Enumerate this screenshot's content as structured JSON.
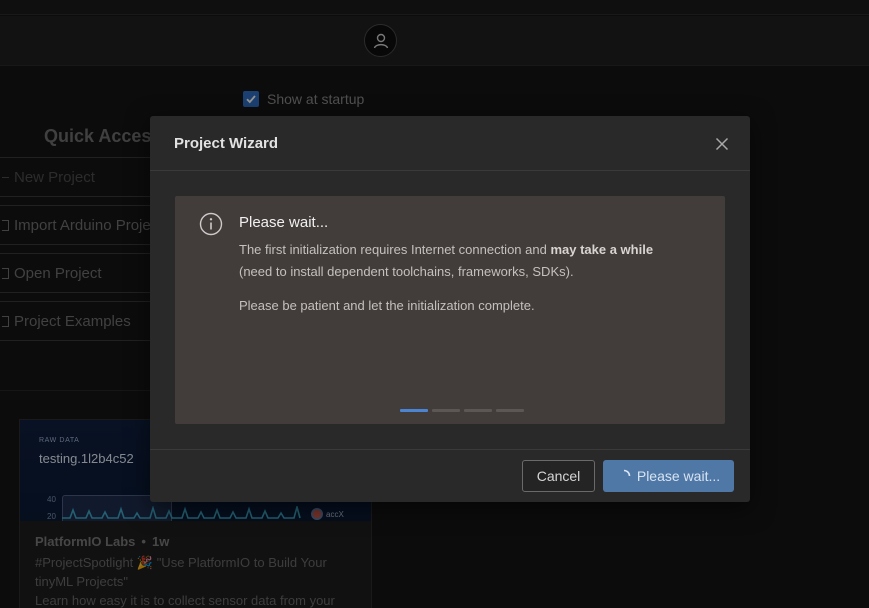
{
  "background": {
    "show_at_startup_label": "Show at startup",
    "show_at_startup_checked": true,
    "quick_access": {
      "title": "Quick Access",
      "items": [
        {
          "label": "New Project"
        },
        {
          "label": "Import Arduino Project"
        },
        {
          "label": "Open Project"
        },
        {
          "label": "Project Examples"
        }
      ]
    },
    "news": {
      "thumb_raw_label": "RAW DATA",
      "thumb_title": "testing.1l2b4c52",
      "thumb_axis_40": "40",
      "thumb_axis_20": "20",
      "thumb_legend": "accX",
      "author": "PlatformIO Labs",
      "separator": "•",
      "age": "1w",
      "line1": "#ProjectSpotlight 🎉 \"Use PlatformIO to Build Your",
      "line2": "tinyML Projects\"",
      "line3": "Learn how easy it is to collect sensor data from your"
    }
  },
  "modal": {
    "title": "Project Wizard",
    "info": {
      "heading": "Please wait...",
      "line1_pre": "The first initialization requires Internet connection and ",
      "line1_bold": "may take a while",
      "line2": "(need to install dependent toolchains, frameworks, SDKs).",
      "line3": "Please be patient and let the initialization complete."
    },
    "progress_segments": 4,
    "progress_active_index": 0,
    "buttons": {
      "cancel": "Cancel",
      "wait": "Please wait..."
    }
  },
  "colors": {
    "accent": "#4a84d2",
    "wait_button": "#4f78a7",
    "checkbox": "#2f6fc3"
  },
  "icons": {
    "avatar": "user-icon",
    "close": "close-icon",
    "info": "info-icon",
    "spinner": "spinner-icon"
  }
}
